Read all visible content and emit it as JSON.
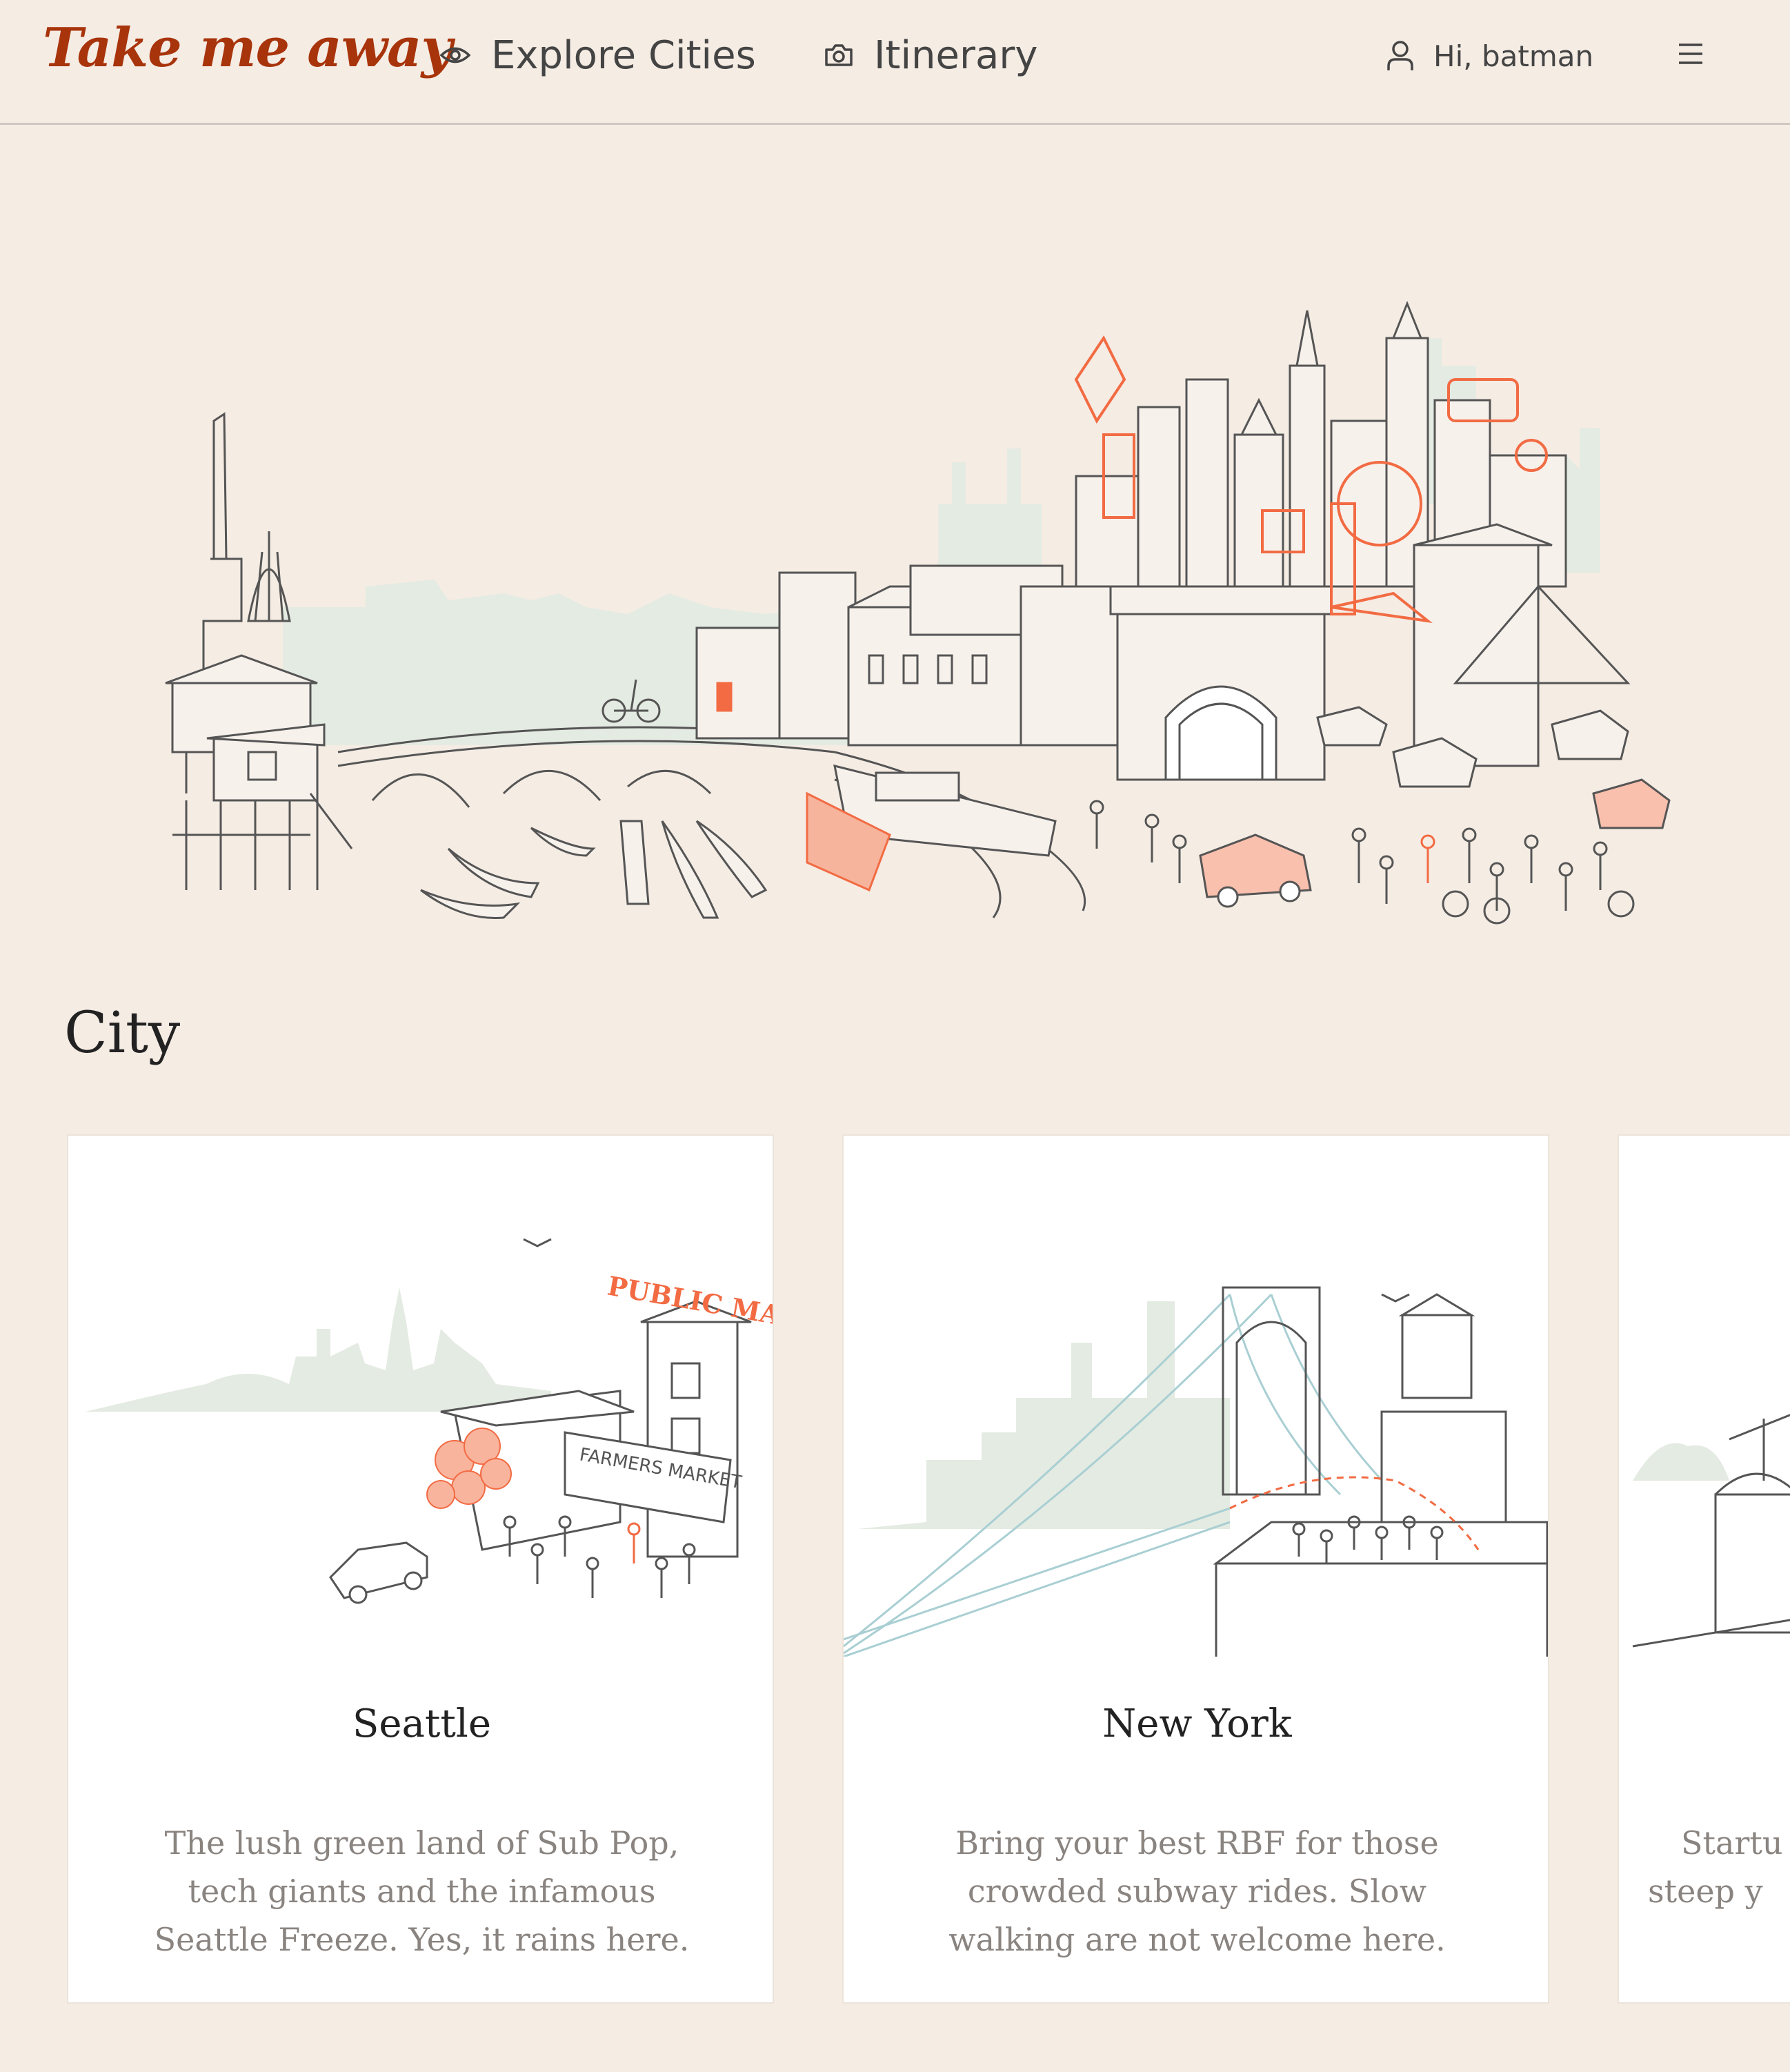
{
  "header": {
    "logo": "Take me away",
    "nav": [
      {
        "label": "Explore Cities",
        "icon": "eye-icon"
      },
      {
        "label": "Itinerary",
        "icon": "camera-icon"
      }
    ],
    "user_greeting": "Hi, batman",
    "user_icon": "user-icon",
    "menu_icon": "hamburger-menu-icon"
  },
  "section": {
    "title": "City"
  },
  "cards": [
    {
      "name": "Seattle",
      "description": "The lush green land of Sub Pop, tech giants and the infamous Seattle Freeze. Yes, it rains here.",
      "sign_text": "PUBLIC MARKET CENTER",
      "market_text": "FARMERS MARKET"
    },
    {
      "name": "New York",
      "description": "Bring your best RBF for those crowded subway rides. Slow walking are not welcome here."
    },
    {
      "name": "",
      "description": "Startu\nsteep y"
    }
  ],
  "colors": {
    "brand": "#a8340b",
    "background": "#f5ece4",
    "accent_orange": "#f26b43",
    "skyline_green": "#e4ebe2",
    "line": "#555555",
    "water_blue": "#a9cfd3"
  }
}
